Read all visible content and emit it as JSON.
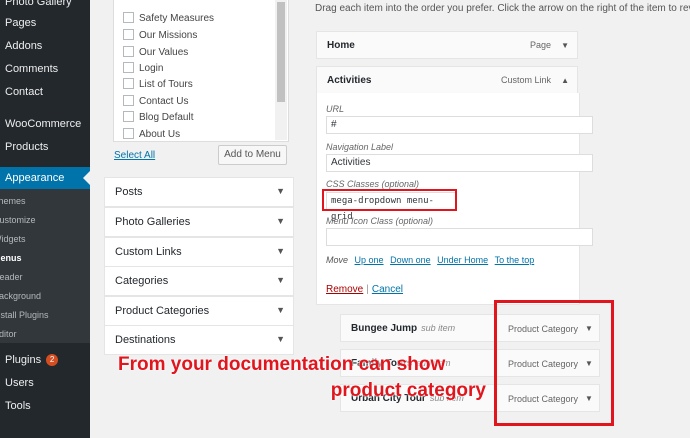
{
  "sidebar": {
    "items": [
      {
        "label": "Photo Gallery"
      },
      {
        "label": "Pages"
      },
      {
        "label": "Addons"
      },
      {
        "label": "Comments"
      },
      {
        "label": "Contact"
      },
      {
        "label": "WooCommerce"
      },
      {
        "label": "Products"
      },
      {
        "label": "Appearance"
      },
      {
        "label": "Plugins",
        "badge": "2"
      },
      {
        "label": "Users"
      },
      {
        "label": "Tools"
      }
    ],
    "submenu": [
      {
        "label": "Themes"
      },
      {
        "label": "Customize"
      },
      {
        "label": "Widgets"
      },
      {
        "label": "Menus"
      },
      {
        "label": "Header"
      },
      {
        "label": "Background"
      },
      {
        "label": "Install Plugins"
      },
      {
        "label": "Editor"
      }
    ]
  },
  "pages_panel": {
    "items": [
      "Safety Measures",
      "Our Missions",
      "Our Values",
      "Login",
      "List of Tours",
      "Contact Us",
      "Blog Default",
      "About Us"
    ],
    "select_all": "Select All",
    "add_button": "Add to Menu"
  },
  "accordion": [
    "Posts",
    "Photo Galleries",
    "Custom Links",
    "Categories",
    "Product Categories",
    "Destinations"
  ],
  "menu_structure": {
    "instructions": "Drag each item into the order you prefer. Click the arrow on the right of the item to reveal",
    "home": {
      "title": "Home",
      "type": "Page"
    },
    "activities": {
      "title": "Activities",
      "type": "Custom Link",
      "url_label": "URL",
      "url_value": "#",
      "nav_label": "Navigation Label",
      "nav_value": "Activities",
      "css_label": "CSS Classes (optional)",
      "css_value": "mega-dropdown menu-grid",
      "icon_label": "Menu Icon Class (optional)",
      "icon_value": "",
      "move_label": "Move",
      "move_links": [
        "Up one",
        "Down one",
        "Under Home",
        "To the top"
      ],
      "remove": "Remove",
      "separator": "|",
      "cancel": "Cancel"
    },
    "sub_items": [
      {
        "title": "Bungee Jump",
        "sub": "sub item",
        "type": "Product Category"
      },
      {
        "title": "Family Tours",
        "sub": "sub item",
        "type": "Product Category"
      },
      {
        "title": "Urban City Tour",
        "sub": "sub item",
        "type": "Product Category"
      }
    ]
  },
  "annotation": {
    "line1": "From your documentation can show",
    "line2": "product category"
  },
  "colors": {
    "sidebar": "#23282d",
    "active": "#0073aa",
    "annotation": "#e0151d"
  }
}
